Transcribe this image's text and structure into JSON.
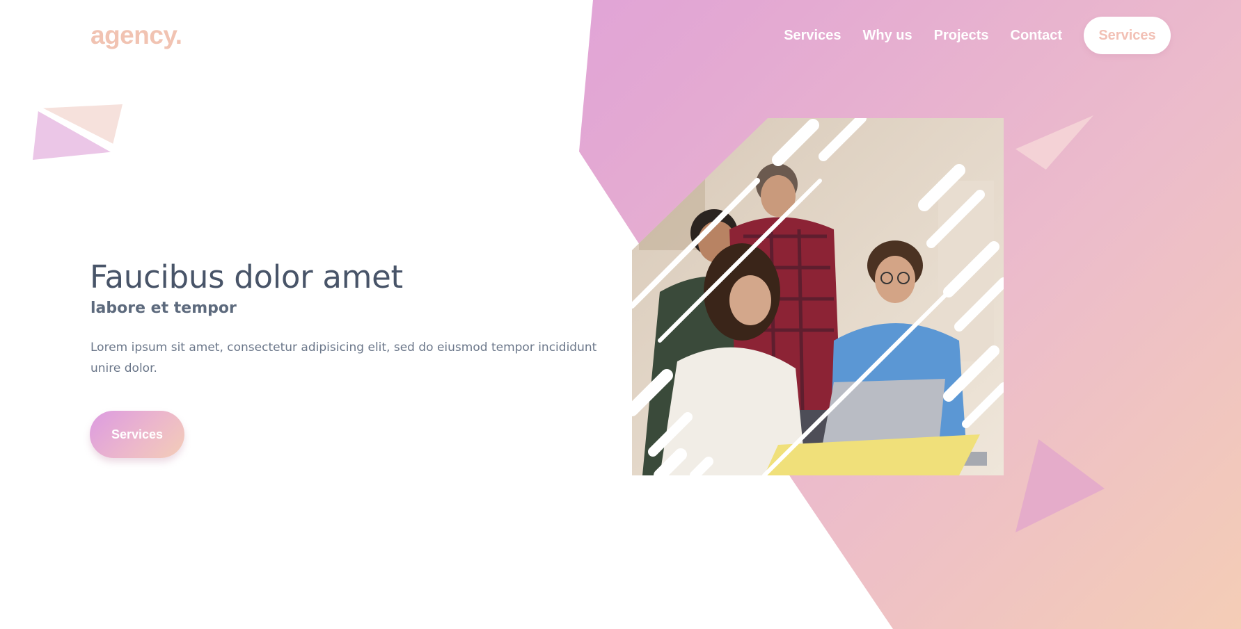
{
  "header": {
    "logo": "agency.",
    "nav": [
      "Services",
      "Why us",
      "Projects",
      "Contact"
    ],
    "cta_label": "Services"
  },
  "hero": {
    "title": "Faucibus dolor amet",
    "subtitle": "labore et tempor",
    "body": "Lorem ipsum sit amet, consectetur adipisicing elit, sed do eiusmod tempor incididunt unire dolor.",
    "button_label": "Services",
    "image_icon": "team-meeting-illustration"
  },
  "colors": {
    "gradient_start": "#d997e3",
    "gradient_end": "#f4cdb6",
    "logo": "#f1c3b2",
    "heading": "#485468",
    "text": "#6a7689"
  }
}
